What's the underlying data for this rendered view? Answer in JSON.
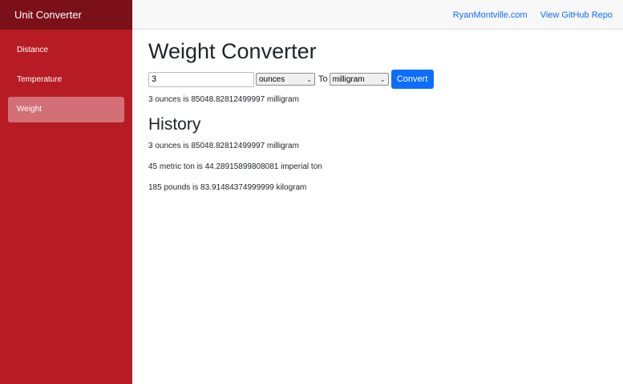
{
  "sidebar": {
    "brand": "Unit Converter",
    "items": [
      {
        "label": "Distance"
      },
      {
        "label": "Temperature"
      },
      {
        "label": "Weight",
        "active": true
      }
    ]
  },
  "topbar": {
    "links": [
      {
        "label": "RyanMontville.com"
      },
      {
        "label": "View GitHub Repo"
      }
    ]
  },
  "converter": {
    "title": "Weight Converter",
    "input_value": "3",
    "from_unit": "ounces",
    "to_label": "To",
    "to_unit": "milligram",
    "convert_label": "Convert",
    "result": "3 ounces is 85048.82812499997 milligram"
  },
  "history": {
    "title": "History",
    "items": [
      "3 ounces is 85048.82812499997 milligram",
      "45 metric ton is 44.28915899808081 imperial ton",
      "185 pounds is 83.91484374999999 kilogram"
    ]
  },
  "colors": {
    "sidebar": "#b71c24",
    "brand_bar": "#7b1018",
    "active_item": "#d37077",
    "primary": "#0d6efd"
  }
}
